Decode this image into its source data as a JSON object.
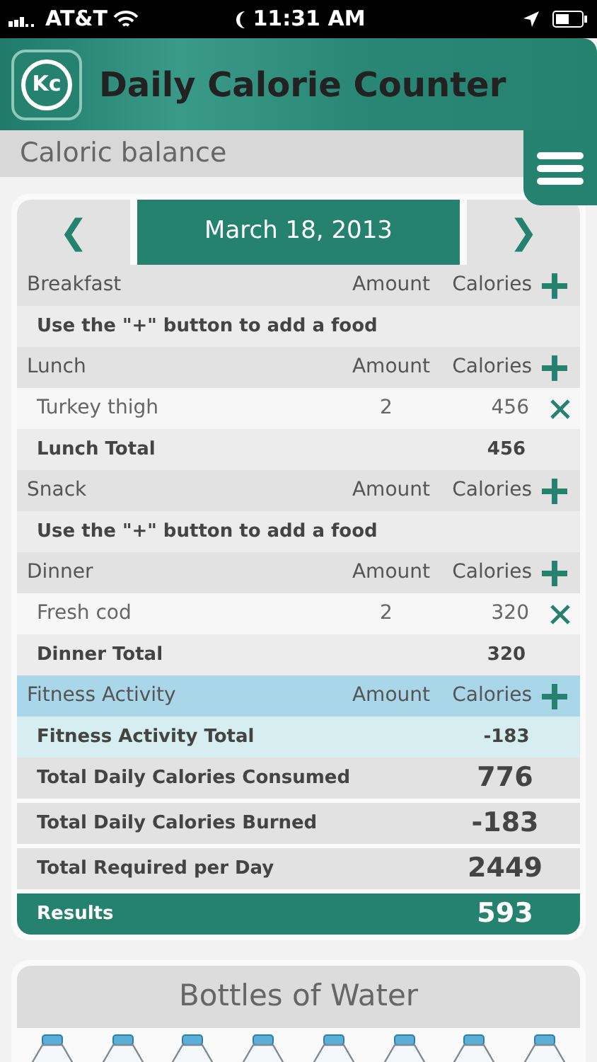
{
  "status_bar": {
    "carrier": "AT&T",
    "time": "11:31 AM"
  },
  "app": {
    "logo": "Kc",
    "title": "Daily Calorie Counter"
  },
  "section_title": "Caloric balance",
  "date_nav": {
    "prev": "❮",
    "date": "March 18, 2013",
    "next": "❯"
  },
  "rows": [
    {
      "kind": "header",
      "label": "Breakfast",
      "amount": "Amount",
      "calories": "Calories"
    },
    {
      "kind": "hint",
      "label": "Use the \"+\" button to add a food"
    },
    {
      "kind": "header",
      "label": "Lunch",
      "amount": "Amount",
      "calories": "Calories"
    },
    {
      "kind": "item",
      "label": "Turkey thigh",
      "amount": "2",
      "calories": "456"
    },
    {
      "kind": "total",
      "label": "Lunch Total",
      "calories": "456"
    },
    {
      "kind": "header",
      "label": "Snack",
      "amount": "Amount",
      "calories": "Calories"
    },
    {
      "kind": "hint",
      "label": "Use the \"+\" button to add a food"
    },
    {
      "kind": "header",
      "label": "Dinner",
      "amount": "Amount",
      "calories": "Calories"
    },
    {
      "kind": "item",
      "label": "Fresh cod",
      "amount": "2",
      "calories": "320"
    },
    {
      "kind": "total",
      "label": "Dinner Total",
      "calories": "320"
    },
    {
      "kind": "fitness_header",
      "label": "Fitness Activity",
      "amount": "Amount",
      "calories": "Calories"
    },
    {
      "kind": "fitness_total",
      "label": "Fitness Activity Total",
      "calories": "-183"
    },
    {
      "kind": "summary",
      "label": "Total Daily Calories Consumed",
      "calories": "776"
    },
    {
      "kind": "summary",
      "label": "Total Daily Calories Burned",
      "calories": "-183"
    },
    {
      "kind": "summary",
      "label": "Total Required per Day",
      "calories": "2449"
    },
    {
      "kind": "result",
      "label": "Results",
      "calories": "593"
    }
  ],
  "water": {
    "title": "Bottles of Water",
    "bottles": [
      {
        "kind": "bottle"
      },
      {
        "kind": "bottle"
      },
      {
        "kind": "bottle"
      },
      {
        "kind": "bottle"
      },
      {
        "kind": "bottle"
      },
      {
        "kind": "bottle"
      },
      {
        "kind": "bottle"
      },
      {
        "kind": "bottle"
      }
    ]
  }
}
